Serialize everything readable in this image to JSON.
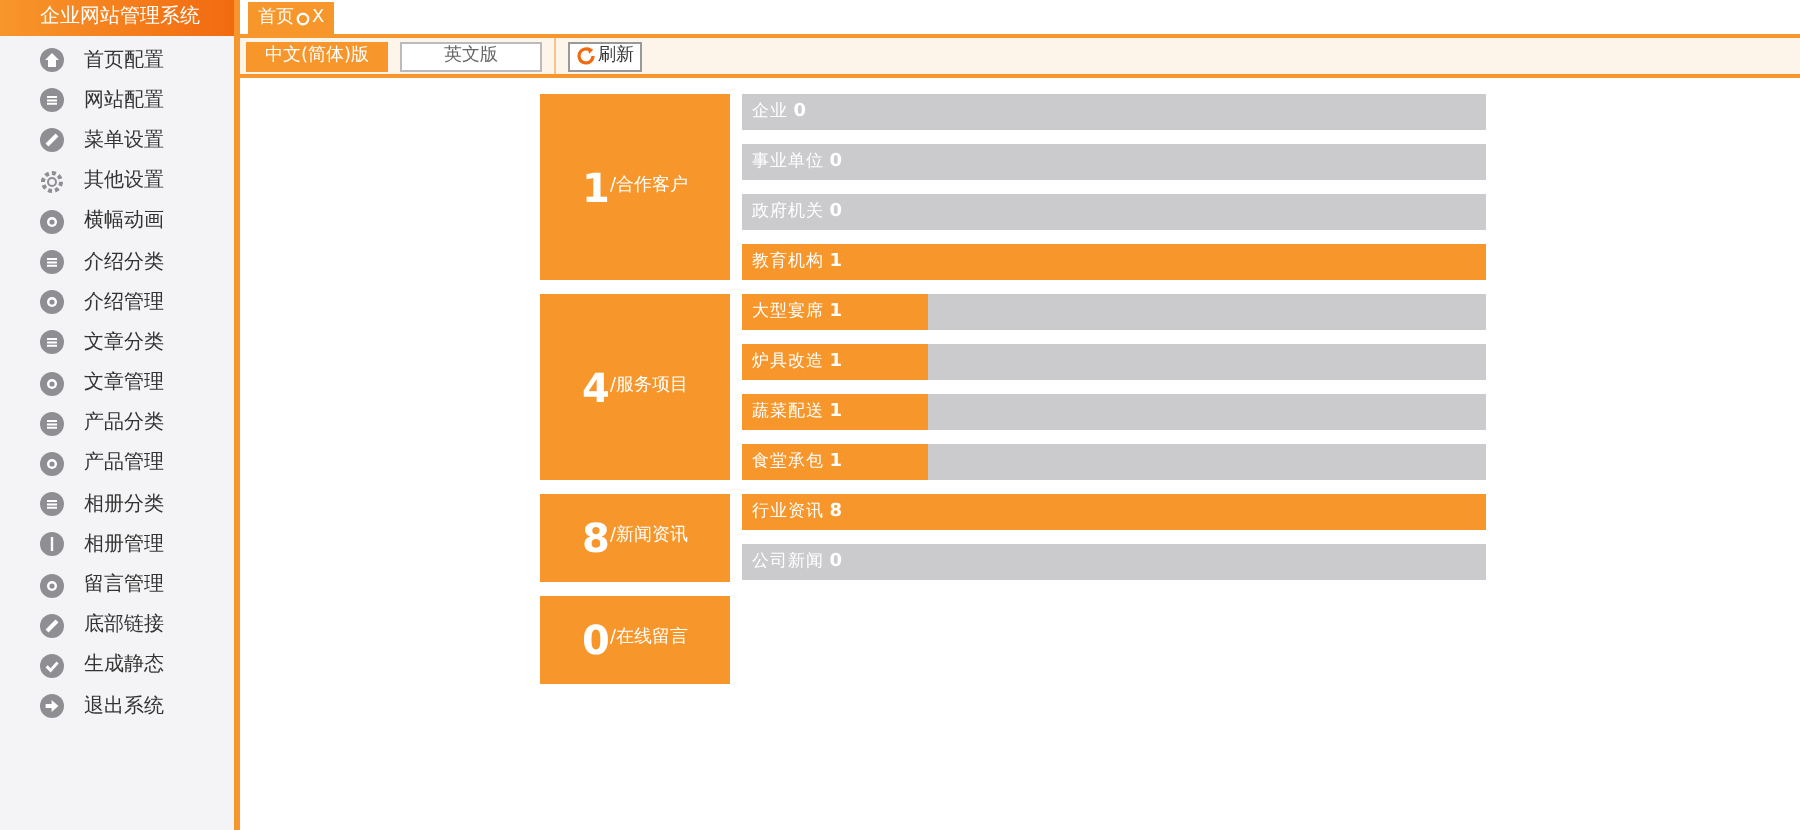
{
  "app_title": "企业网站管理系统",
  "sidebar": {
    "items": [
      {
        "label": "首页配置"
      },
      {
        "label": "网站配置"
      },
      {
        "label": "菜单设置"
      },
      {
        "label": "其他设置"
      },
      {
        "label": "横幅动画"
      },
      {
        "label": "介绍分类"
      },
      {
        "label": "介绍管理"
      },
      {
        "label": "文章分类"
      },
      {
        "label": "文章管理"
      },
      {
        "label": "产品分类"
      },
      {
        "label": "产品管理"
      },
      {
        "label": "相册分类"
      },
      {
        "label": "相册管理"
      },
      {
        "label": "留言管理"
      },
      {
        "label": "底部链接"
      },
      {
        "label": "生成静态"
      },
      {
        "label": "退出系统"
      }
    ]
  },
  "tabs": [
    {
      "label": "首页",
      "close": "X",
      "selected": true
    }
  ],
  "languages": [
    {
      "label": "中文(简体)版",
      "selected": true
    },
    {
      "label": "英文版",
      "selected": false
    }
  ],
  "refresh_button": "刷新",
  "stats": [
    {
      "count": "1",
      "label": "/合作客户",
      "items": [
        {
          "name": "企业",
          "value": "0",
          "level": 0
        },
        {
          "name": "事业单位",
          "value": "0",
          "level": 0
        },
        {
          "name": "政府机关",
          "value": "0",
          "level": 0
        },
        {
          "name": "教育机构",
          "value": "1",
          "level": 1
        }
      ]
    },
    {
      "count": "4",
      "label": "/服务项目",
      "items": [
        {
          "name": "大型宴席",
          "value": "1",
          "level": 0.25
        },
        {
          "name": "炉具改造",
          "value": "1",
          "level": 0.25
        },
        {
          "name": "蔬菜配送",
          "value": "1",
          "level": 0.25
        },
        {
          "name": "食堂承包",
          "value": "1",
          "level": 0.25
        }
      ]
    },
    {
      "count": "8",
      "label": "/新闻资讯",
      "items": [
        {
          "name": "行业资讯",
          "value": "8",
          "level": 1
        },
        {
          "name": "公司新闻",
          "value": "0",
          "level": 0
        }
      ]
    },
    {
      "count": "0",
      "label": "/在线留言"
    }
  ]
}
